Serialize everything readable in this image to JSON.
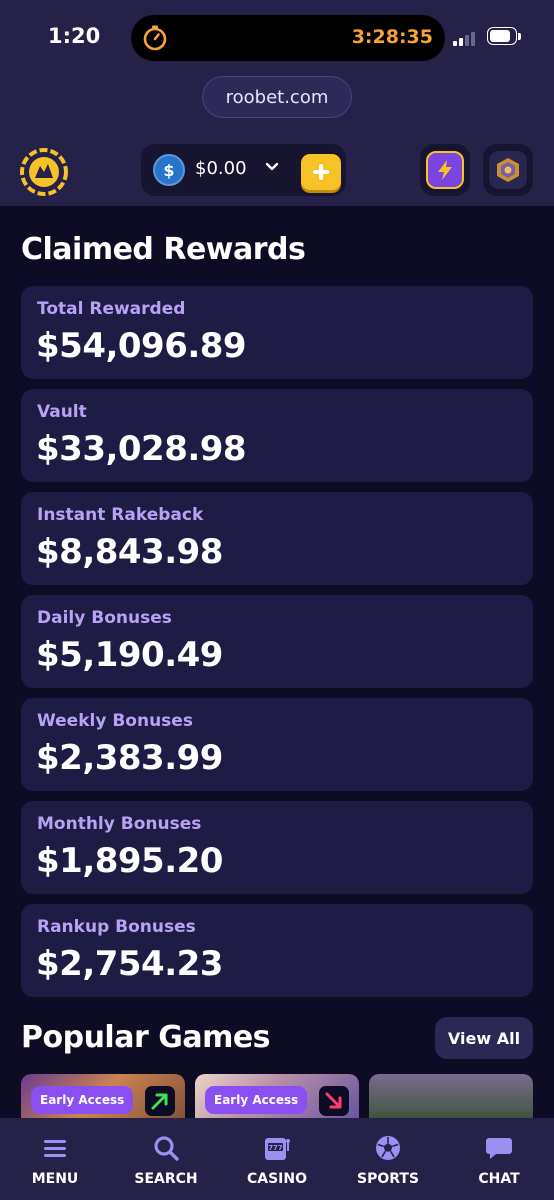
{
  "status_bar": {
    "time": "1:20",
    "timer": "3:28:35"
  },
  "browser": {
    "url": "roobet.com"
  },
  "header": {
    "balance": "$0.00",
    "coin_symbol": "$"
  },
  "rewards": {
    "title": "Claimed Rewards",
    "items": [
      {
        "label": "Total Rewarded",
        "value": "$54,096.89"
      },
      {
        "label": "Vault",
        "value": "$33,028.98"
      },
      {
        "label": "Instant Rakeback",
        "value": "$8,843.98"
      },
      {
        "label": "Daily Bonuses",
        "value": "$5,190.49"
      },
      {
        "label": "Weekly Bonuses",
        "value": "$2,383.99"
      },
      {
        "label": "Monthly Bonuses",
        "value": "$1,895.20"
      },
      {
        "label": "Rankup Bonuses",
        "value": "$2,754.23"
      }
    ]
  },
  "popular_games": {
    "title": "Popular Games",
    "view_all_label": "View All",
    "games": [
      {
        "badge": "Early Access",
        "trend": "up"
      },
      {
        "badge": "Early Access",
        "trend": "down"
      },
      {
        "badge": "",
        "trend": ""
      }
    ]
  },
  "bottom_nav": {
    "items": [
      {
        "label": "MENU",
        "icon": "menu-icon"
      },
      {
        "label": "SEARCH",
        "icon": "search-icon"
      },
      {
        "label": "CASINO",
        "icon": "slot-machine-icon"
      },
      {
        "label": "SPORTS",
        "icon": "soccer-ball-icon"
      },
      {
        "label": "CHAT",
        "icon": "chat-icon"
      }
    ]
  },
  "colors": {
    "background": "#0d0c24",
    "panel": "#252148",
    "card": "#1e1b44",
    "label_purple": "#b8a2f4",
    "accent_yellow": "#f6c228",
    "accent_purple": "#8a4ff0",
    "timer_orange": "#f7a33a"
  }
}
